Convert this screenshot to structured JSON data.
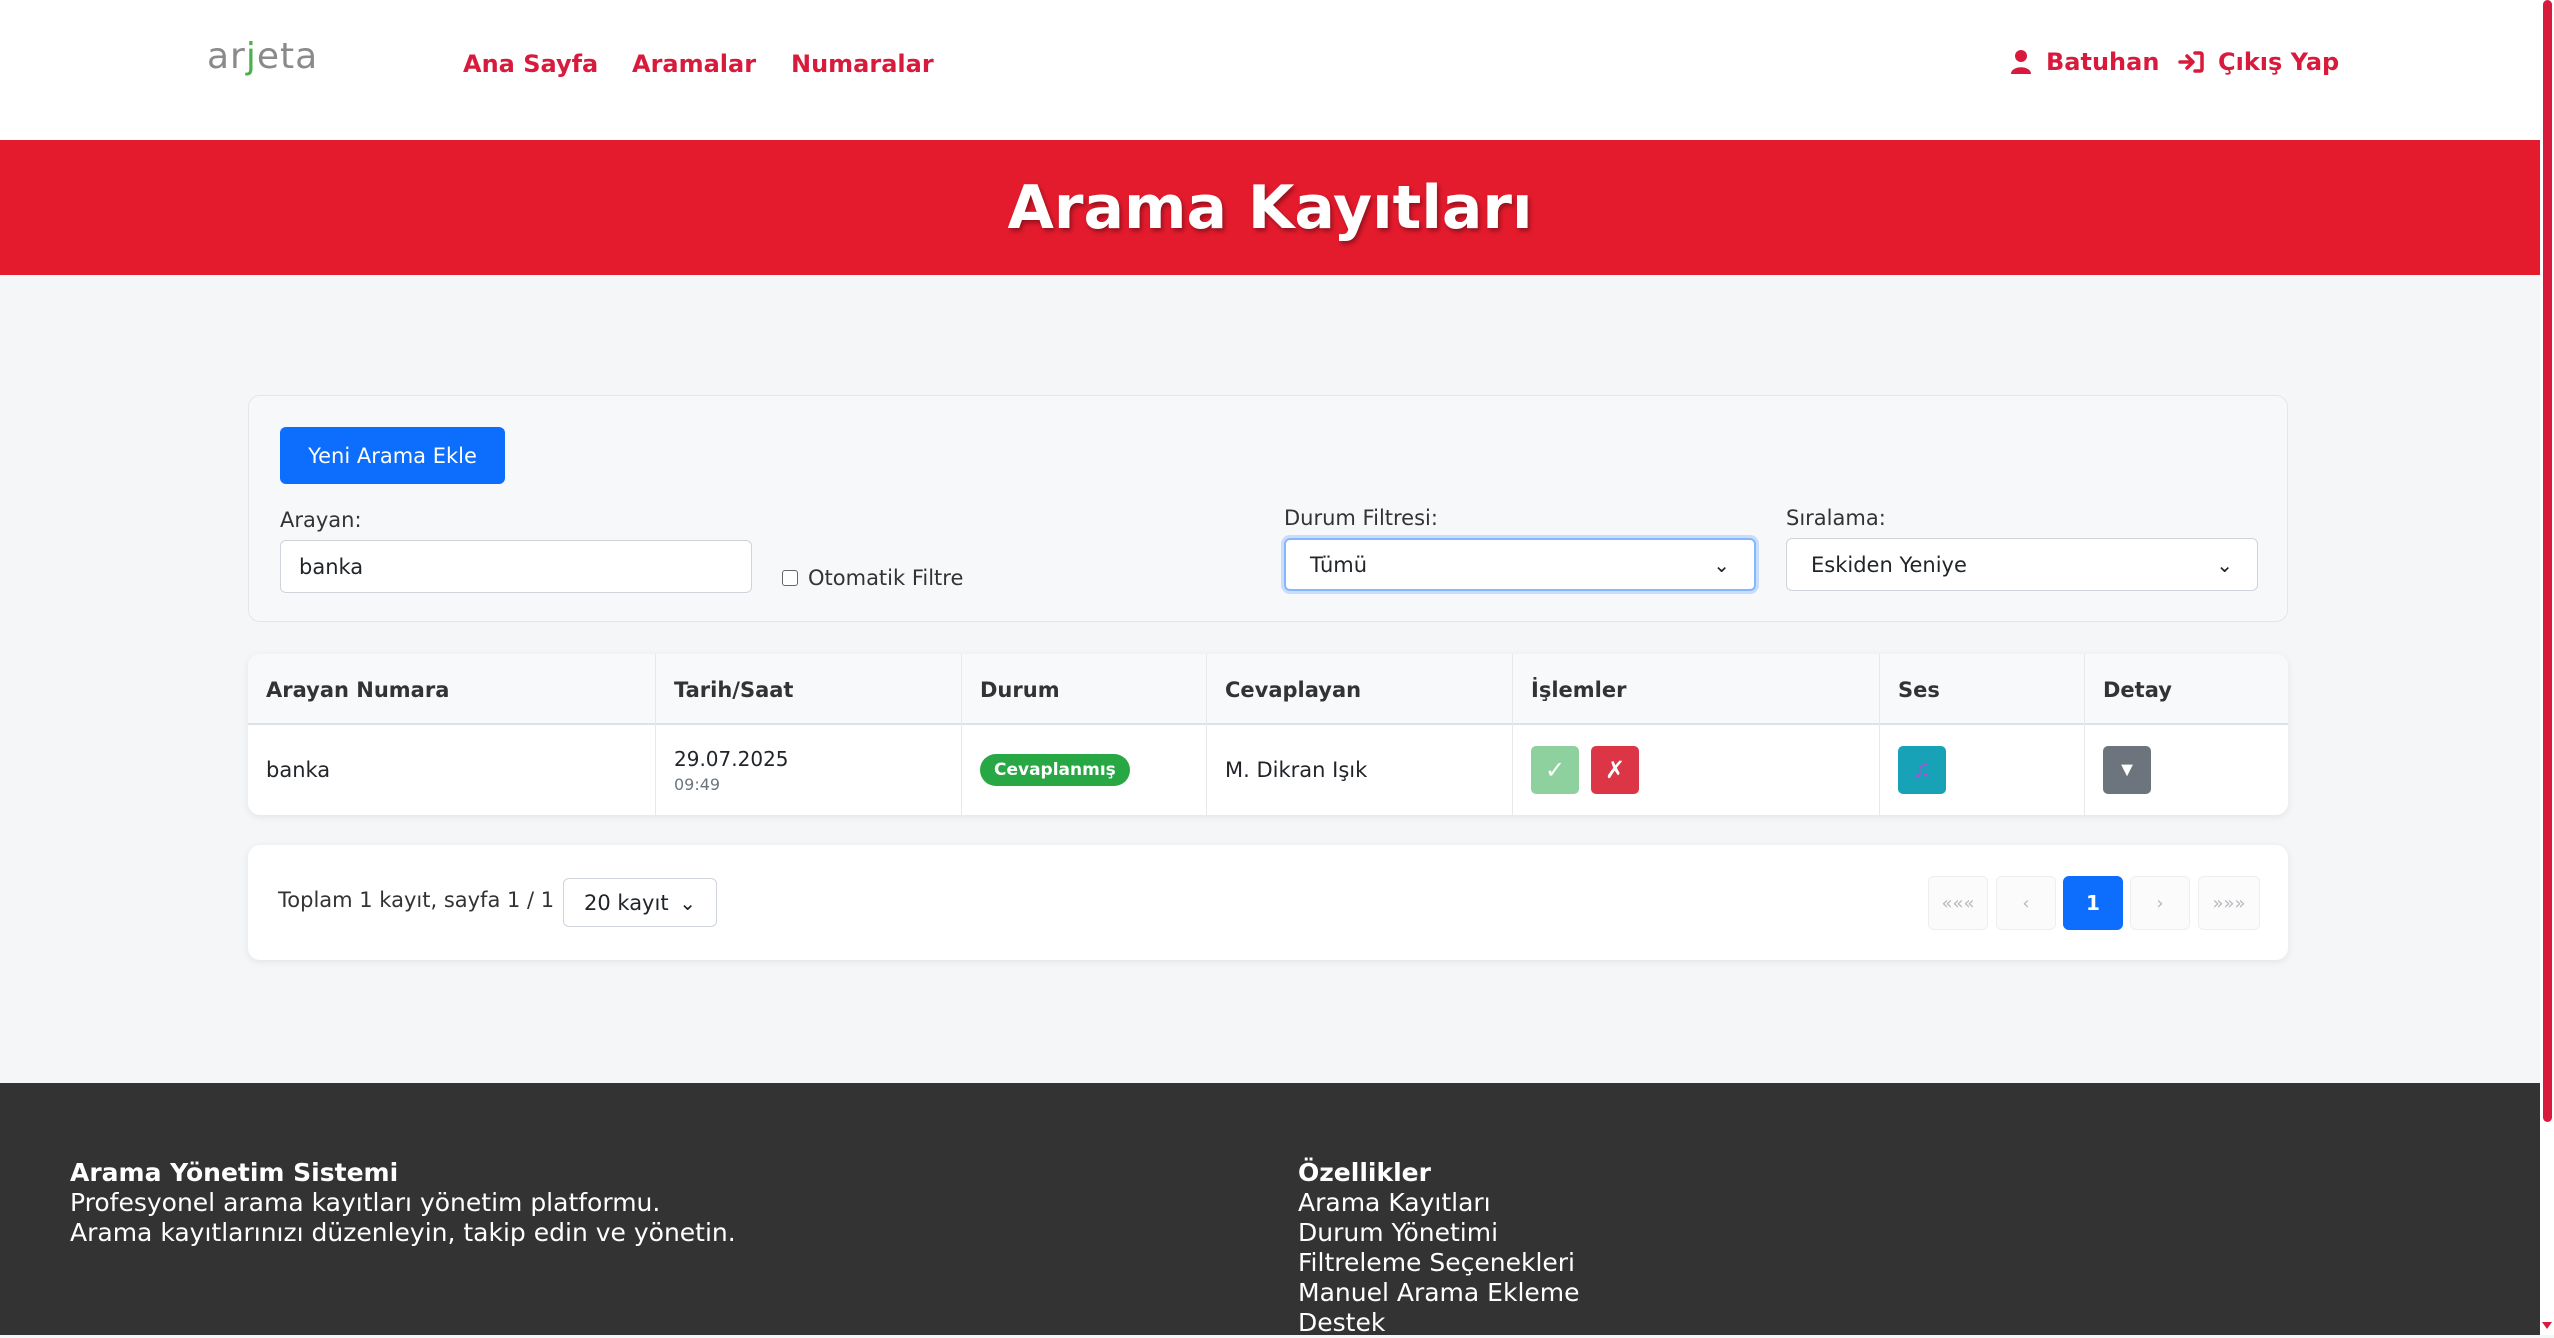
{
  "navbar": {
    "logo_part1": "ar",
    "logo_part2": "j",
    "logo_part3": "eta",
    "links": [
      "Ana Sayfa",
      "Aramalar",
      "Numaralar"
    ],
    "user_name": "Batuhan",
    "logout_label": "Çıkış Yap"
  },
  "hero": {
    "title": "Arama Kayıtları"
  },
  "filters": {
    "add_button": "Yeni Arama Ekle",
    "caller_label": "Arayan:",
    "caller_value": "banka",
    "auto_filter_label": "Otomatik Filtre",
    "auto_filter_checked": false,
    "status_label": "Durum Filtresi:",
    "status_value": "Tümü",
    "sort_label": "Sıralama:",
    "sort_value": "Eskiden Yeniye"
  },
  "table": {
    "headers": [
      "Arayan Numara",
      "Tarih/Saat",
      "Durum",
      "Cevaplayan",
      "İşlemler",
      "Ses",
      "Detay"
    ],
    "rows": [
      {
        "caller": "banka",
        "date": "29.07.2025",
        "time": "09:49",
        "status": "Cevaplanmış",
        "answered_by": "M. Dikran Işık",
        "action_ok": "✓",
        "action_no": "✗",
        "audio_icon": "♫",
        "detail_icon": "▼"
      }
    ]
  },
  "pagination": {
    "info": "Toplam 1 kayıt, sayfa 1 / 1",
    "per_page": "20 kayıt",
    "first": "«««",
    "prev": "‹",
    "current": "1",
    "next": "›",
    "last": "»»»"
  },
  "footer": {
    "col1": {
      "title": "Arama Yönetim Sistemi",
      "lines": [
        "Profesyonel arama kayıtları yönetim platformu.",
        "Arama kayıtlarınızı düzenleyin, takip edin ve yönetin."
      ]
    },
    "col2": {
      "title": "Özellikler",
      "items": [
        "Arama Kayıtları",
        "Durum Yönetimi",
        "Filtreleme Seçenekleri",
        "Manuel Arama Ekleme",
        "Destek"
      ]
    }
  },
  "colors": {
    "brand_red": "#e31b2d",
    "nav_link": "#d81b3c",
    "primary": "#0d6efd",
    "success": "#28a745",
    "danger": "#dc3545",
    "info": "#17a2b8",
    "secondary": "#6c757d",
    "footer_bg": "#333333"
  }
}
